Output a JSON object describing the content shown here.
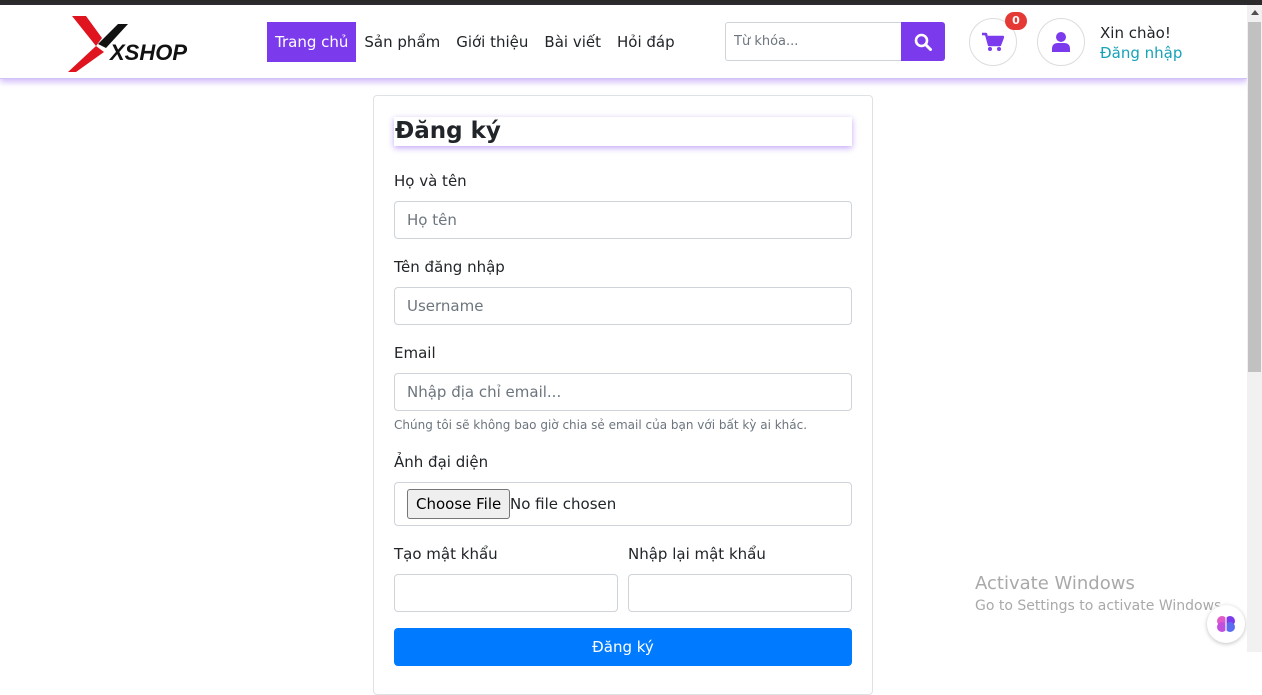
{
  "header": {
    "logo_text": "XSHOP",
    "nav": [
      "Trang chủ",
      "Sản phẩm",
      "Giới thiệu",
      "Bài viết",
      "Hỏi đáp"
    ],
    "search_placeholder": "Từ khóa...",
    "cart_count": "0",
    "greeting": "Xin chào!",
    "login_label": "Đăng nhập"
  },
  "form": {
    "title": "Đăng ký",
    "fullname_label": "Họ và tên",
    "fullname_placeholder": "Họ tên",
    "username_label": "Tên đăng nhập",
    "username_placeholder": "Username",
    "email_label": "Email",
    "email_placeholder": "Nhập địa chỉ email...",
    "email_help": "Chúng tôi sẽ không bao giờ chia sẻ email của bạn với bất kỳ ai khác.",
    "avatar_label": "Ảnh đại diện",
    "file_button": "Choose File",
    "file_status": "No file chosen",
    "password_label": "Tạo mật khẩu",
    "password_confirm_label": "Nhập lại mật khẩu",
    "submit_label": "Đăng ký"
  },
  "watermark": {
    "line1": "Activate Windows",
    "line2": "Go to Settings to activate Windows."
  },
  "colors": {
    "accent": "#7c3aed",
    "primary_button": "#007bff",
    "link": "#17a2b8",
    "badge": "#e53935"
  }
}
